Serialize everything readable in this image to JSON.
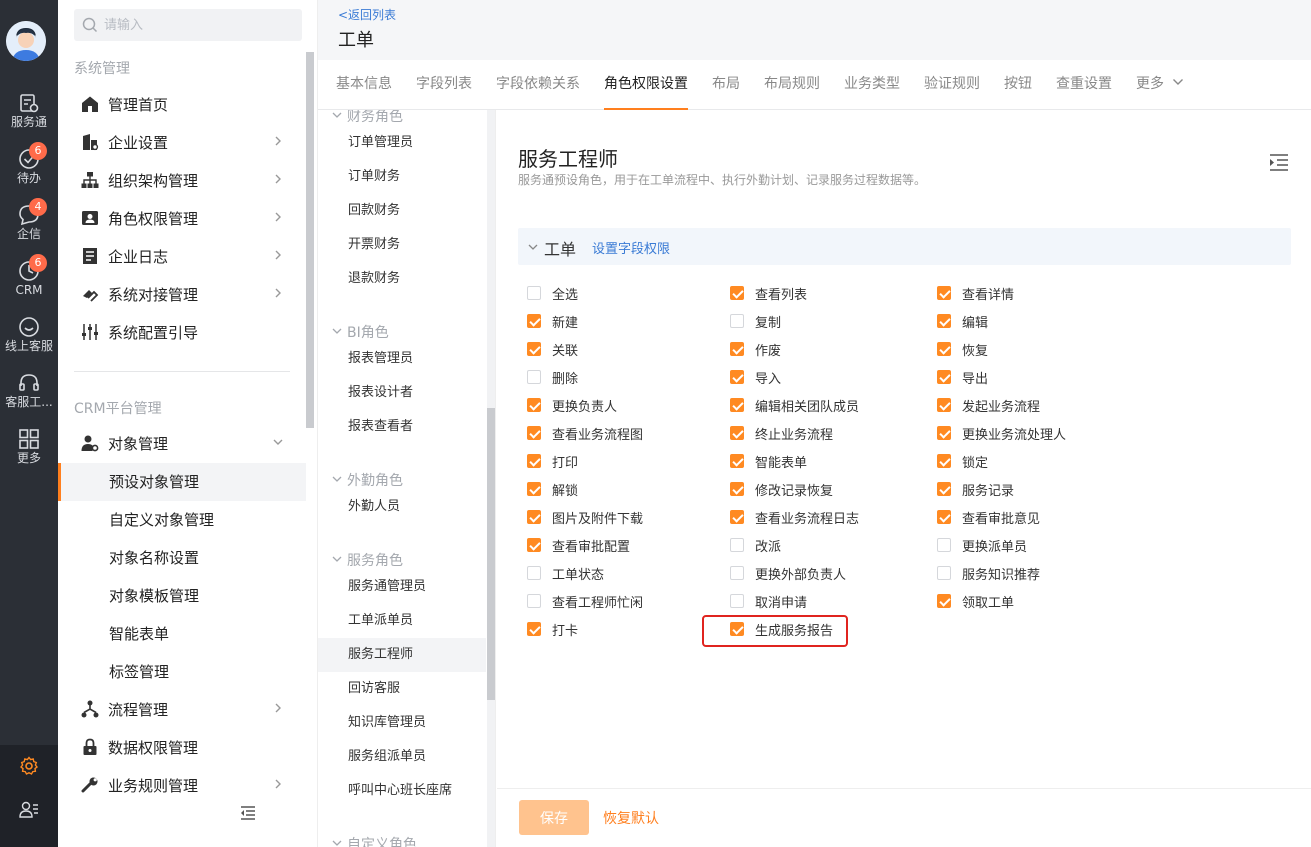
{
  "rail": {
    "items": [
      {
        "label": "服务通",
        "icon": "clipboard-gear-icon"
      },
      {
        "label": "待办",
        "icon": "check-circle-icon",
        "badge": "6"
      },
      {
        "label": "企信",
        "icon": "chat-bubble-icon",
        "badge": "4"
      },
      {
        "label": "CRM",
        "icon": "clock-icon",
        "badge": "6"
      },
      {
        "label": "线上客服",
        "icon": "smile-icon"
      },
      {
        "label": "客服工...",
        "icon": "headset-icon"
      },
      {
        "label": "更多",
        "icon": "grid-icon"
      }
    ]
  },
  "nav": {
    "search_placeholder": "请输入",
    "section1": "系统管理",
    "section1_items": [
      {
        "label": "管理首页"
      },
      {
        "label": "企业设置"
      },
      {
        "label": "组织架构管理"
      },
      {
        "label": "角色权限管理"
      },
      {
        "label": "企业日志"
      },
      {
        "label": "系统对接管理"
      },
      {
        "label": "系统配置引导"
      }
    ],
    "section2": "CRM平台管理",
    "object_mgmt": "对象管理",
    "object_sub": [
      {
        "label": "预设对象管理",
        "active": true
      },
      {
        "label": "自定义对象管理"
      },
      {
        "label": "对象名称设置"
      },
      {
        "label": "对象模板管理"
      },
      {
        "label": "智能表单"
      },
      {
        "label": "标签管理"
      }
    ],
    "section2_items": [
      {
        "label": "流程管理"
      },
      {
        "label": "数据权限管理"
      },
      {
        "label": "业务规则管理"
      }
    ]
  },
  "header": {
    "back": "<返回列表",
    "title": "工单"
  },
  "tabs": [
    "基本信息",
    "字段列表",
    "字段依赖关系",
    "角色权限设置",
    "布局",
    "布局规则",
    "业务类型",
    "验证规则",
    "按钮",
    "查重设置",
    "更多"
  ],
  "active_tab": "角色权限设置",
  "roles": {
    "groups": [
      {
        "name": "财务角色",
        "items": [
          "订单管理员",
          "订单财务",
          "回款财务",
          "开票财务",
          "退款财务"
        ]
      },
      {
        "name": "BI角色",
        "items": [
          "报表管理员",
          "报表设计者",
          "报表查看者"
        ]
      },
      {
        "name": "外勤角色",
        "items": [
          "外勤人员"
        ]
      },
      {
        "name": "服务角色",
        "items": [
          "服务通管理员",
          "工单派单员",
          "服务工程师",
          "回访客服",
          "知识库管理员",
          "服务组派单员",
          "呼叫中心班长座席"
        ]
      },
      {
        "name": "自定义角色",
        "items": []
      }
    ],
    "active": "服务工程师"
  },
  "main": {
    "role_title": "服务工程师",
    "role_desc": "服务通预设角色，用于在工单流程中、执行外勤计划、记录服务过程数据等。",
    "object_name": "工单",
    "field_perm_link": "设置字段权限",
    "permissions": [
      {
        "label": "全选",
        "checked": false
      },
      {
        "label": "查看列表",
        "checked": true
      },
      {
        "label": "查看详情",
        "checked": true
      },
      {
        "label": "新建",
        "checked": true
      },
      {
        "label": "复制",
        "checked": false
      },
      {
        "label": "编辑",
        "checked": true
      },
      {
        "label": "关联",
        "checked": true
      },
      {
        "label": "作废",
        "checked": true
      },
      {
        "label": "恢复",
        "checked": true
      },
      {
        "label": "删除",
        "checked": false
      },
      {
        "label": "导入",
        "checked": true
      },
      {
        "label": "导出",
        "checked": true
      },
      {
        "label": "更换负责人",
        "checked": true
      },
      {
        "label": "编辑相关团队成员",
        "checked": true
      },
      {
        "label": "发起业务流程",
        "checked": true
      },
      {
        "label": "查看业务流程图",
        "checked": true
      },
      {
        "label": "终止业务流程",
        "checked": true
      },
      {
        "label": "更换业务流处理人",
        "checked": true
      },
      {
        "label": "打印",
        "checked": true
      },
      {
        "label": "智能表单",
        "checked": true
      },
      {
        "label": "锁定",
        "checked": true
      },
      {
        "label": "解锁",
        "checked": true
      },
      {
        "label": "修改记录恢复",
        "checked": true
      },
      {
        "label": "服务记录",
        "checked": true
      },
      {
        "label": "图片及附件下载",
        "checked": true
      },
      {
        "label": "查看业务流程日志",
        "checked": true
      },
      {
        "label": "查看审批意见",
        "checked": true
      },
      {
        "label": "查看审批配置",
        "checked": true
      },
      {
        "label": "改派",
        "checked": false
      },
      {
        "label": "更换派单员",
        "checked": false
      },
      {
        "label": "工单状态",
        "checked": false
      },
      {
        "label": "更换外部负责人",
        "checked": false
      },
      {
        "label": "服务知识推荐",
        "checked": false
      },
      {
        "label": "查看工程师忙闲",
        "checked": false
      },
      {
        "label": "取消申请",
        "checked": false
      },
      {
        "label": "领取工单",
        "checked": true
      },
      {
        "label": "打卡",
        "checked": true
      },
      {
        "label": "生成服务报告",
        "checked": true,
        "highlighted": true
      }
    ],
    "save_label": "保存",
    "reset_label": "恢复默认"
  },
  "colors": {
    "accent": "#ff7f1e",
    "checkbox": "#ff8a22",
    "link": "#3a7bd5",
    "rail": "#2b2f36",
    "highlight": "#e0241f"
  }
}
